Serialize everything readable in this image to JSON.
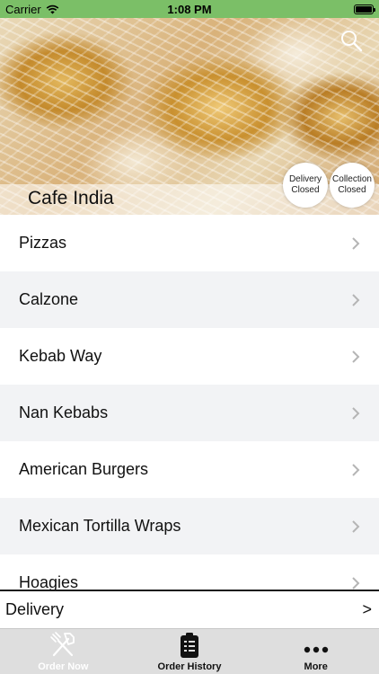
{
  "status_bar": {
    "carrier": "Carrier",
    "time": "1:08 PM"
  },
  "hero": {
    "restaurant_name": "Cafe India",
    "delivery": {
      "line1": "Delivery",
      "line2": "Closed"
    },
    "collection": {
      "line1": "Collection",
      "line2": "Closed"
    }
  },
  "menu": {
    "categories": [
      "Pizzas",
      "Calzone",
      "Kebab Way",
      "Nan Kebabs",
      "American Burgers",
      "Mexican Tortilla Wraps",
      "Hoagies"
    ]
  },
  "delivery_bar": {
    "label": "Delivery",
    "arrow": ">"
  },
  "tab_bar": {
    "tabs": [
      {
        "label": "Order Now",
        "icon": "fork-knife-icon",
        "active": true
      },
      {
        "label": "Order History",
        "icon": "clipboard-list-icon",
        "active": false
      },
      {
        "label": "More",
        "icon": "ellipsis-icon",
        "active": false
      }
    ]
  },
  "colors": {
    "status_bar": "#7bbf67",
    "alt_row": "#f2f3f5",
    "tab_bar": "#dedede"
  }
}
